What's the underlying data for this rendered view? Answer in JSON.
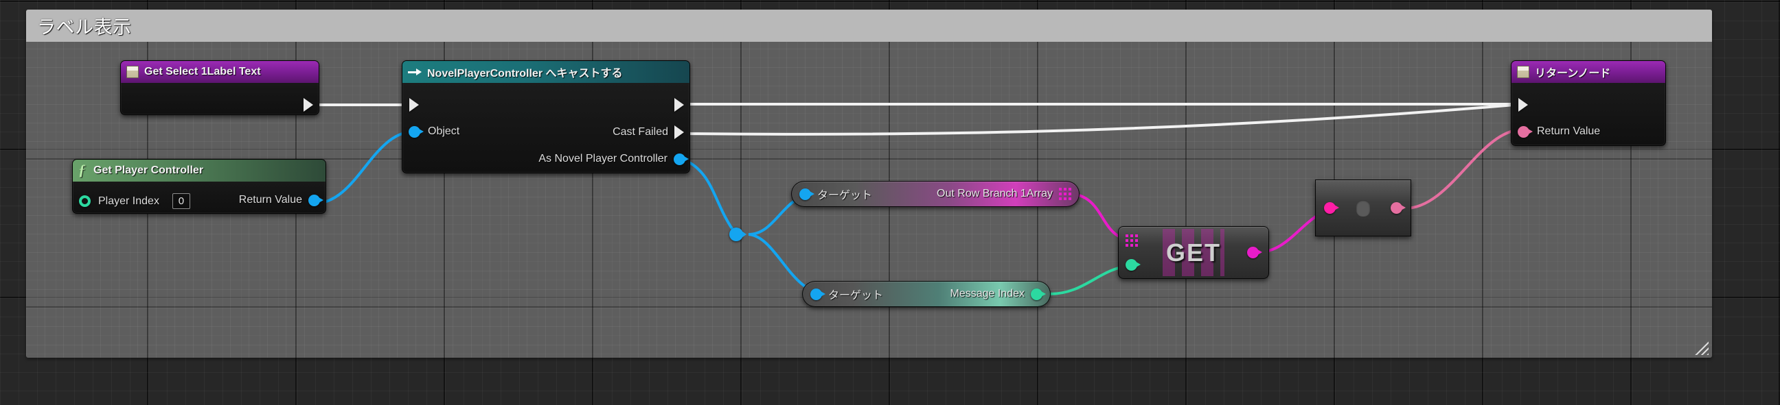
{
  "comment": {
    "title": "ラベル表示",
    "resize_handle": "resize-handle-icon"
  },
  "colors": {
    "exec_wire": "#f2f2f2",
    "object_pin": "#14a5f0",
    "exec_pin": "#e9e9e9",
    "struct_pin": "#e81cc9",
    "int_pin": "#2cd9a0",
    "text_pin": "#e56fa0",
    "node_purple": "#7d1f96",
    "node_teal": "#1b6f76",
    "node_green": "#4e7d55"
  },
  "nodes": {
    "get_select_label_text": {
      "title": "Get Select 1Label Text",
      "header_icon": "variable-icon",
      "out_exec": "exec-out-pin"
    },
    "cast_node": {
      "title": "NovelPlayerController へキャストする",
      "header_icon": "cast-icon",
      "in_exec": "exec-in-pin",
      "in_object_label": "Object",
      "out_exec": "exec-out-pin",
      "out_cast_failed_label": "Cast Failed",
      "out_as_label": "As Novel Player Controller"
    },
    "get_player_controller": {
      "title": "Get Player Controller",
      "header_icon": "function-icon",
      "in_label": "Player Index",
      "in_value": "0",
      "out_label": "Return Value"
    },
    "target_out_row": {
      "in_label": "ターゲット",
      "out_label": "Out Row Branch 1Array",
      "out_pin_kind": "array-pin"
    },
    "target_message_index": {
      "in_label": "ターゲット",
      "out_label": "Message Index",
      "out_pin_kind": "int-pin"
    },
    "get_array_element": {
      "title": "GET",
      "in_array_pin": "array-pin",
      "in_index_pin": "int-pin",
      "out_pin": "struct-pin"
    },
    "collapsed_node": {
      "in_pin": "struct-pin",
      "middle": "collapsed-body",
      "out_pin": "text-pin"
    },
    "return_node": {
      "title": "リターンノード",
      "header_icon": "variable-icon",
      "in_exec": "exec-in-pin",
      "in_label": "Return Value"
    }
  }
}
